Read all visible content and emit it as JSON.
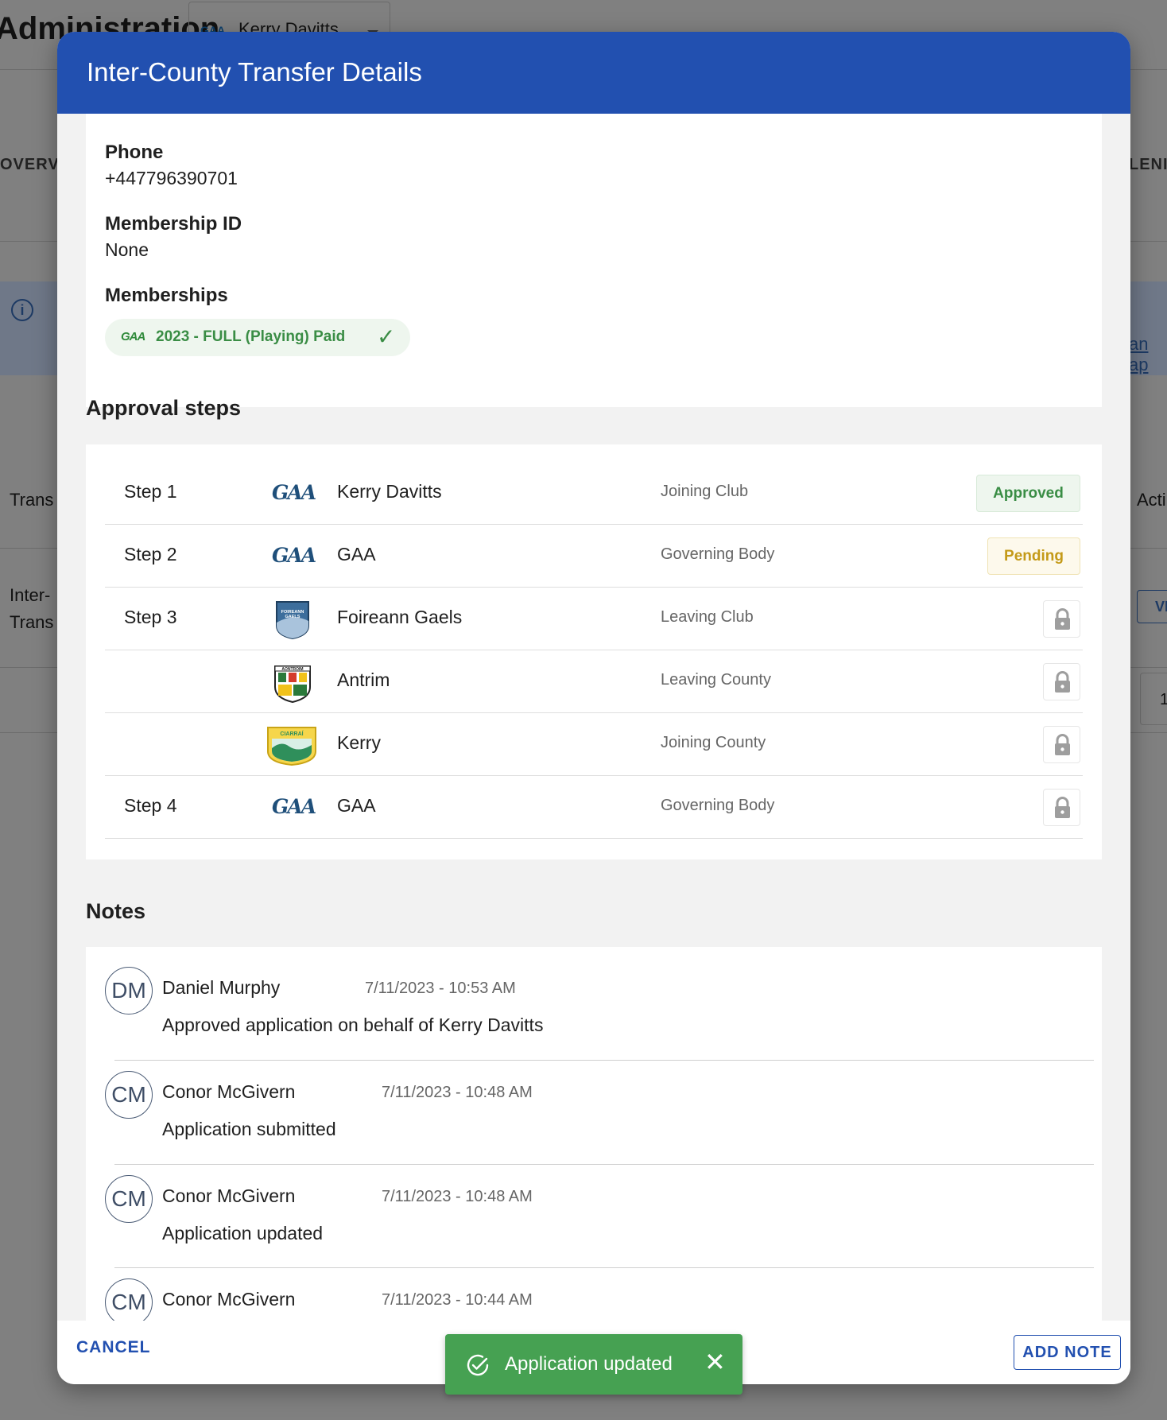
{
  "background": {
    "page_title": "Administration",
    "club_selector": "Kerry Davitts",
    "club_logo": "GAA",
    "tab_left": "OVERV",
    "tab_right": "LENI",
    "info_right_link": "an ap",
    "col_left": "Trans",
    "col_right": "Acti",
    "row_left_line1": "Inter-",
    "row_left_line2": "Trans",
    "row_button": "VI",
    "page_number": "1"
  },
  "modal": {
    "title": "Inter-County Transfer Details",
    "phone_label": "Phone",
    "phone_value": "+447796390701",
    "membership_id_label": "Membership ID",
    "membership_id_value": "None",
    "memberships_label": "Memberships",
    "membership_chip_logo": "GAA",
    "membership_chip": "2023 - FULL (Playing) Paid",
    "approval_title": "Approval steps",
    "steps": [
      {
        "step": "Step 1",
        "logo": "gaa-logo",
        "org": "Kerry Davitts",
        "role": "Joining Club",
        "status": "Approved"
      },
      {
        "step": "Step 2",
        "logo": "gaa-logo",
        "org": "GAA",
        "role": "Governing Body",
        "status": "Pending"
      },
      {
        "step": "Step 3",
        "logo": "foireann-gaels-crest",
        "org": "Foireann Gaels",
        "role": "Leaving Club",
        "status": "locked"
      },
      {
        "step": "",
        "logo": "antrim-crest",
        "org": "Antrim",
        "role": "Leaving County",
        "status": "locked"
      },
      {
        "step": "",
        "logo": "kerry-crest",
        "org": "Kerry",
        "role": "Joining County",
        "status": "locked"
      },
      {
        "step": "Step 4",
        "logo": "gaa-logo",
        "org": "GAA",
        "role": "Governing Body",
        "status": "locked"
      }
    ],
    "gaa_logo_text": "GAA",
    "foireann_crest_text": "FOIREANN GAELS",
    "antrim_crest_text": "AONTROIM",
    "kerry_crest_text": "CIARRAÍ",
    "notes_title": "Notes",
    "notes": [
      {
        "initials": "DM",
        "author": "Daniel Murphy",
        "time": "7/11/2023 - 10:53 AM",
        "body": "Approved application on behalf of Kerry Davitts"
      },
      {
        "initials": "CM",
        "author": "Conor McGivern",
        "time": "7/11/2023 - 10:48 AM",
        "body": "Application submitted"
      },
      {
        "initials": "CM",
        "author": "Conor McGivern",
        "time": "7/11/2023 - 10:48 AM",
        "body": "Application updated"
      },
      {
        "initials": "CM",
        "author": "Conor McGivern",
        "time": "7/11/2023 - 10:44 AM",
        "body": ""
      }
    ],
    "cancel_label": "CANCEL",
    "add_note_label": "ADD NOTE"
  },
  "toast": {
    "message": "Application updated",
    "close_icon": "close-icon",
    "status_icon": "check-circle-icon"
  },
  "colors": {
    "header_blue": "#2250b0",
    "approved_green": "#3a8d45",
    "pending_gold": "#c49a18",
    "toast_green": "#46a152"
  }
}
